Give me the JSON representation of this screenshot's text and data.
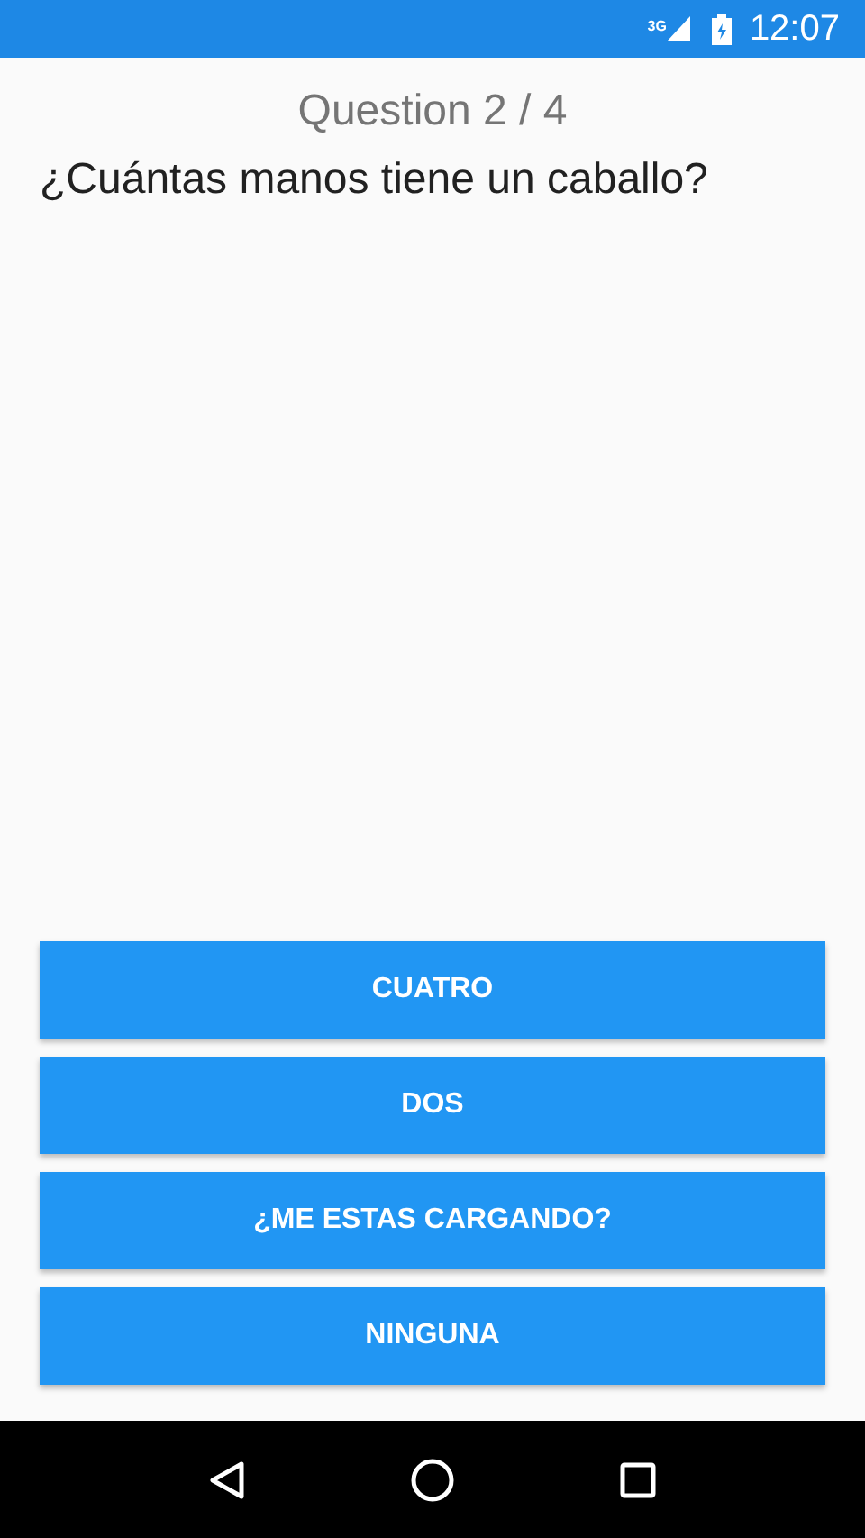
{
  "status_bar": {
    "network": "3G",
    "time": "12:07"
  },
  "counter": "Question 2 / 4",
  "question": "¿Cuántas manos tiene un caballo?",
  "answers": [
    {
      "label": "CUATRO"
    },
    {
      "label": "DOS"
    },
    {
      "label": "¿ME ESTAS CARGANDO?"
    },
    {
      "label": "NINGUNA"
    }
  ]
}
